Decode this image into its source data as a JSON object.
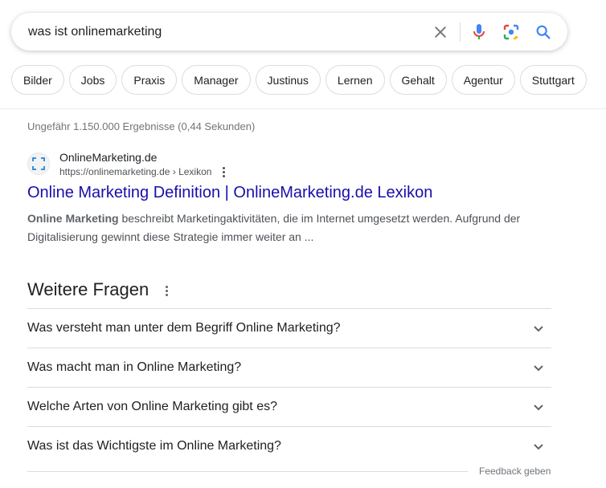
{
  "search": {
    "query": "was ist onlinemarketing",
    "icons": [
      "close-icon",
      "mic-icon",
      "lens-icon",
      "search-icon"
    ]
  },
  "chips": [
    "Bilder",
    "Jobs",
    "Praxis",
    "Manager",
    "Justinus",
    "Lernen",
    "Gehalt",
    "Agentur",
    "Stuttgart"
  ],
  "stats": "Ungefähr 1.150.000 Ergebnisse (0,44 Sekunden)",
  "result": {
    "site_name": "OnlineMarketing.de",
    "url": "https://onlinemarketing.de › Lexikon",
    "title": "Online Marketing Definition | OnlineMarketing.de Lexikon",
    "snippet_bold": "Online Marketing",
    "snippet_rest": " beschreibt Marketingaktivitäten, die im Internet umgesetzt werden. Aufgrund der Digitalisierung gewinnt diese Strategie immer weiter an ..."
  },
  "paa": {
    "title": "Weitere Fragen",
    "questions": [
      "Was versteht man unter dem Begriff Online Marketing?",
      "Was macht man in Online Marketing?",
      "Welche Arten von Online Marketing gibt es?",
      "Was ist das Wichtigste im Online Marketing?"
    ]
  },
  "feedback": "Feedback geben",
  "colors": {
    "link": "#1a0dab",
    "google_blue": "#4285f4",
    "google_red": "#ea4335",
    "google_yellow": "#fbbc04",
    "google_green": "#34a853"
  }
}
